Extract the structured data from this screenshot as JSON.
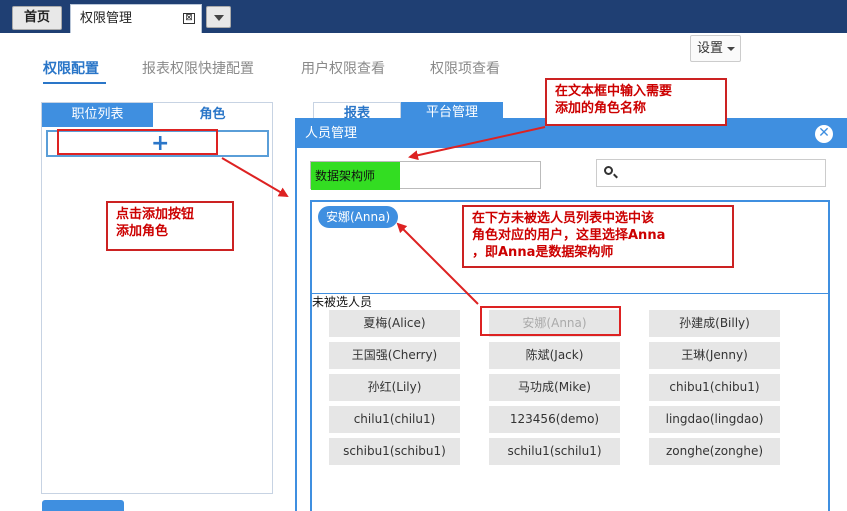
{
  "topbar": {
    "home_label": "首页",
    "tab_label": "权限管理",
    "tab_close_glyph": "⊠"
  },
  "settings": {
    "label": "设置"
  },
  "main_tabs": [
    {
      "label": "权限配置",
      "active": true
    },
    {
      "label": "报表权限快捷配置",
      "active": false
    },
    {
      "label": "用户权限查看",
      "active": false
    },
    {
      "label": "权限项查看",
      "active": false
    }
  ],
  "left_panel": {
    "tab_positions": "职位列表",
    "tab_roles": "角色",
    "add_glyph": "+"
  },
  "right_tabs": {
    "report": "报表",
    "platform": "平台管理"
  },
  "dialog": {
    "title": "人员管理",
    "close_glyph": "✕",
    "role_name_value": "数据架构师",
    "selected_users": [
      "安娜(Anna)"
    ],
    "unselected_label": "未被选人员",
    "unselected_users": [
      [
        "夏梅(Alice)",
        "安娜(Anna)",
        "孙建成(Billy)"
      ],
      [
        "王国强(Cherry)",
        "陈斌(Jack)",
        "王琳(Jenny)"
      ],
      [
        "孙红(Lily)",
        "马功成(Mike)",
        "chibu1(chibu1)"
      ],
      [
        "chilu1(chilu1)",
        "123456(demo)",
        "lingdao(lingdao)"
      ],
      [
        "schibu1(schibu1)",
        "schilu1(schilu1)",
        "zonghe(zonghe)"
      ]
    ]
  },
  "annotations": {
    "input_hint_line1": "在文本框中输入需要",
    "input_hint_line2": "添加的角色名称",
    "add_hint_line1": "点击添加按钮",
    "add_hint_line2": "添加角色",
    "select_hint_line1": "在下方未被选人员列表中选中该",
    "select_hint_line2": "角色对应的用户，这里选择Anna",
    "select_hint_line3": "，即Anna是数据架构师"
  },
  "colors": {
    "accent": "#3f8fe0",
    "annotation": "#d22222",
    "highlight": "#33dd22",
    "topbar": "#1f3f73"
  }
}
